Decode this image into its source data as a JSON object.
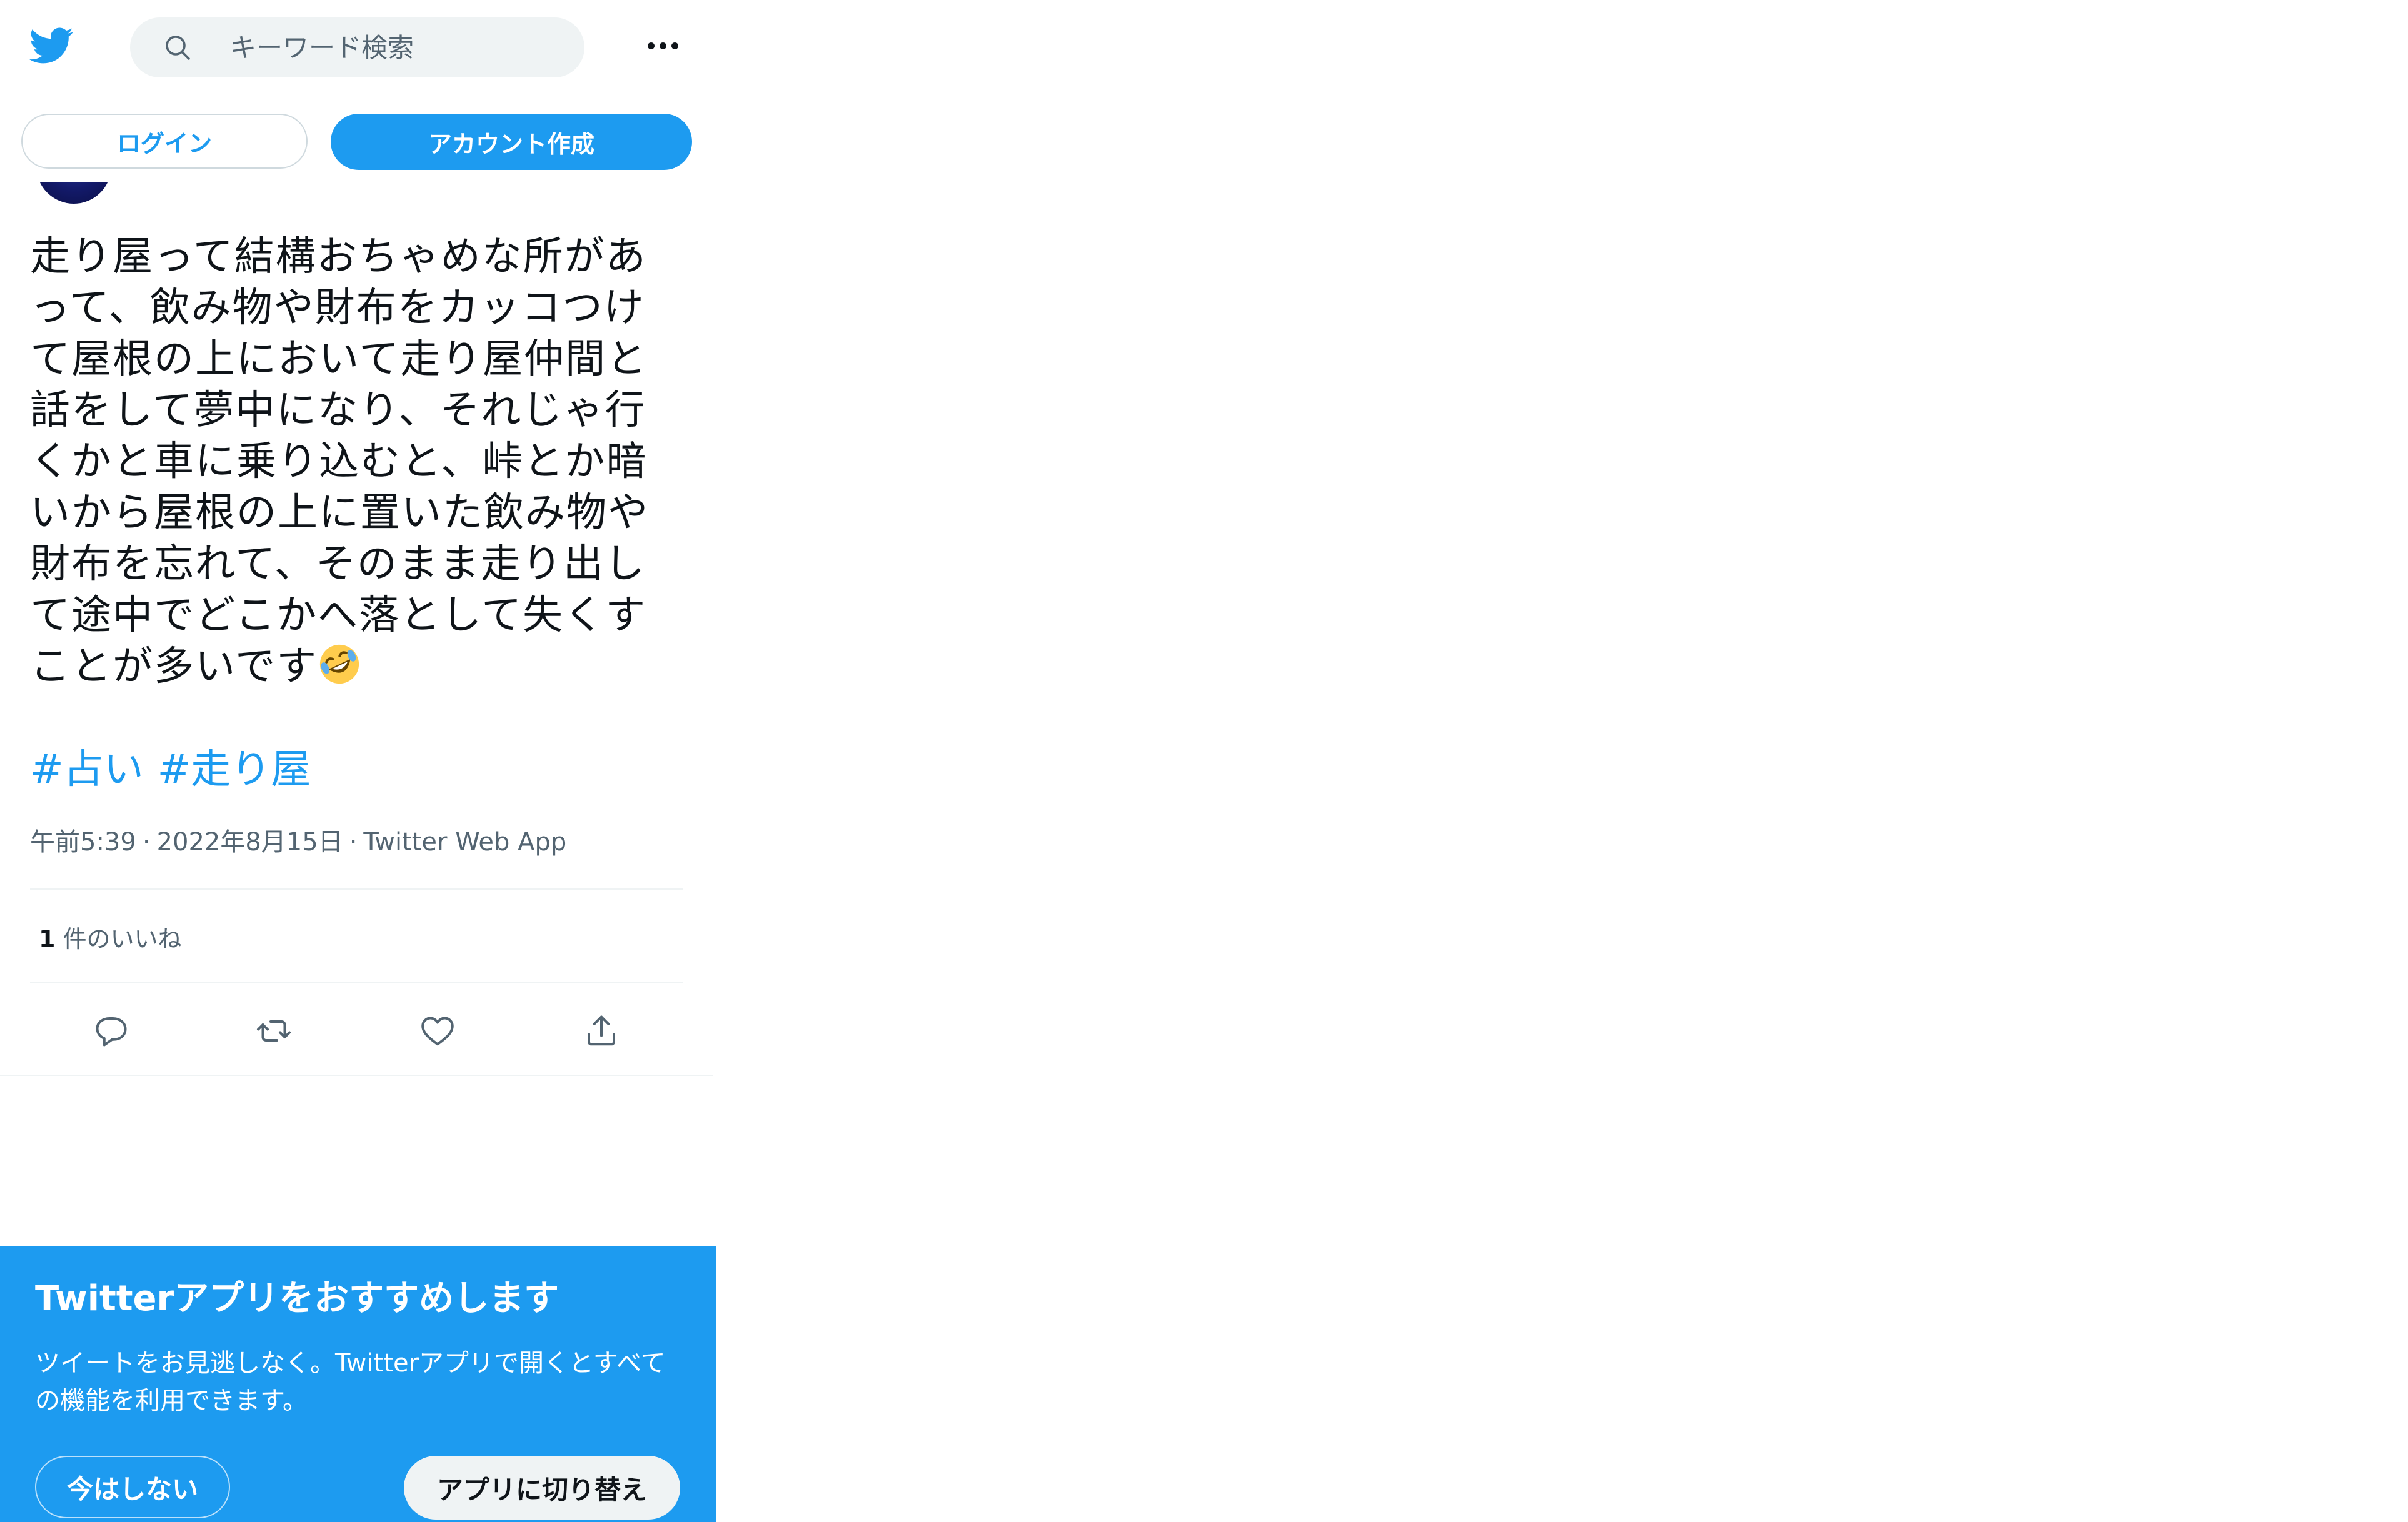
{
  "header": {
    "search_placeholder": "キーワード検索",
    "login_label": "ログイン",
    "signup_label": "アカウント作成"
  },
  "tweet": {
    "text": "走り屋って結構おちゃめな所があって、飲み物や財布をカッコつけて屋根の上において走り屋仲間と話をして夢中になり、それじゃ行くかと車に乗り込むと、峠とか暗いから屋根の上に置いた飲み物や財布を忘れて、そのまま走り出して途中でどこかへ落として失くすことが多いです",
    "emoji": "rolling-on-the-floor-laughing",
    "hashtags": [
      "#占い",
      "#走り屋"
    ],
    "time": "午前5:39",
    "date": "2022年8月15日",
    "source": "Twitter Web App",
    "separator": "·",
    "likes_count": "1",
    "likes_label": "件のいいね"
  },
  "promo": {
    "title": "Twitterアプリをおすすめします",
    "body": "ツイートをお見逃しなく。Twitterアプリで開くとすべての機能を利用できます。",
    "later_label": "今はしない",
    "switch_label": "アプリに切り替え"
  },
  "colors": {
    "accent": "#1d9bf0",
    "text": "#0f1419",
    "secondary_text": "#536471",
    "search_bg": "#eff3f4"
  },
  "icons": [
    "twitter-bird-icon",
    "search-icon",
    "more-icon",
    "reply-icon",
    "retweet-icon",
    "like-icon",
    "share-icon"
  ]
}
